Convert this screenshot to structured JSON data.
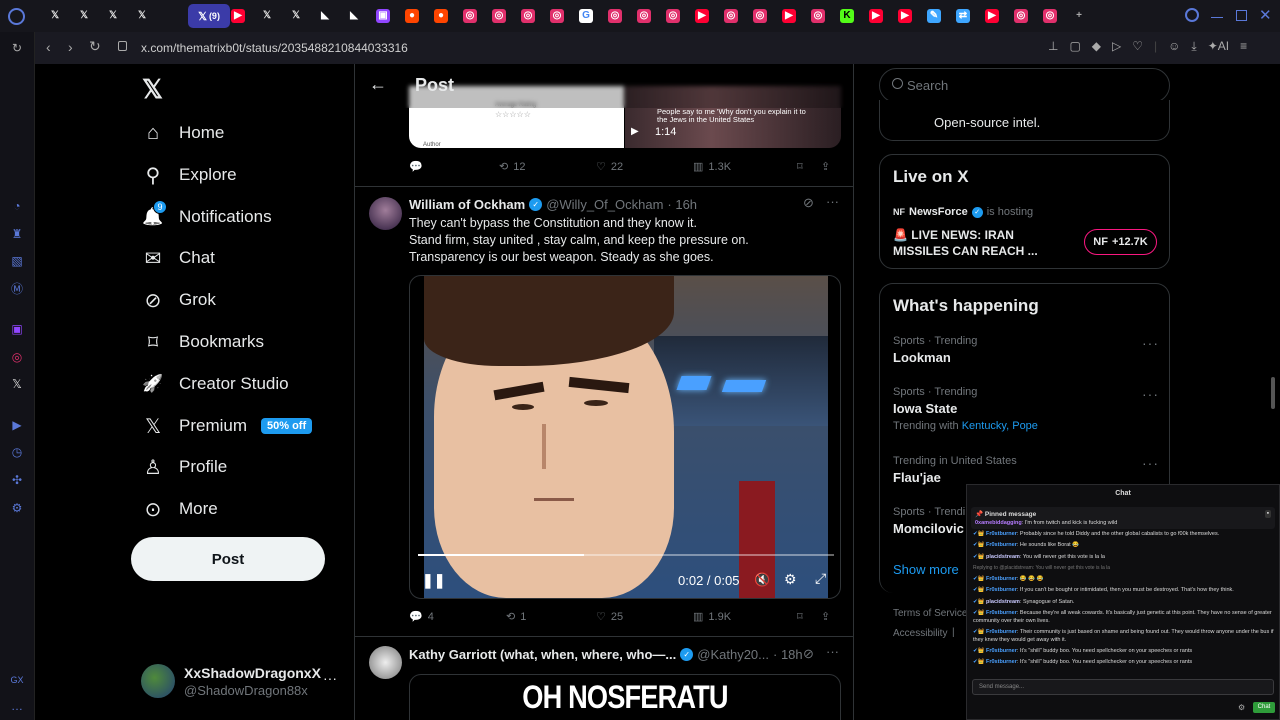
{
  "browser": {
    "active_tab_label": "(9)",
    "url": "x.com/thematrixb0t/status/2035488210844033316",
    "tab_icons": [
      "x-logo",
      "x-logo",
      "x-logo",
      "x-logo",
      "youtube",
      "youtube",
      "x-logo",
      "x-logo",
      "reader",
      "reader",
      "twitch",
      "reddit",
      "reddit",
      "instagram",
      "instagram",
      "instagram",
      "instagram",
      "google",
      "instagram",
      "instagram",
      "instagram",
      "youtube",
      "instagram",
      "instagram",
      "youtube",
      "instagram",
      "kick",
      "youtube",
      "youtube",
      "edit",
      "translate",
      "youtube",
      "instagram",
      "instagram",
      "plus"
    ]
  },
  "nav": {
    "items": [
      {
        "label": "Home",
        "icon": "home-icon"
      },
      {
        "label": "Explore",
        "icon": "search-icon"
      },
      {
        "label": "Notifications",
        "icon": "bell-icon",
        "badge": "9"
      },
      {
        "label": "Chat",
        "icon": "mail-icon"
      },
      {
        "label": "Grok",
        "icon": "grok-icon"
      },
      {
        "label": "Bookmarks",
        "icon": "bookmark-icon"
      },
      {
        "label": "Creator Studio",
        "icon": "rocket-icon"
      },
      {
        "label": "Premium",
        "icon": "x-logo-icon",
        "badge": "50% off"
      },
      {
        "label": "Profile",
        "icon": "person-icon"
      },
      {
        "label": "More",
        "icon": "more-circle-icon"
      }
    ],
    "post_button": "Post",
    "account": {
      "name": "XxShadowDragonxX",
      "handle": "@ShadowDragon88x"
    }
  },
  "header": {
    "title": "Post"
  },
  "prev_post": {
    "rating_label": "Average Rating",
    "author_label": "Author",
    "video_caption": "People say to me 'Why don't you explain it to the Jews in the United States",
    "video_time": "1:14",
    "stats": {
      "replies": "",
      "reposts": "12",
      "likes": "22",
      "views": "1.3K"
    }
  },
  "post": {
    "name": "William of Ockham",
    "handle": "@Willy_Of_Ockham",
    "time": "· 16h",
    "lines": [
      "They can't bypass the Constitution and they know it.",
      "Stand firm, stay united , stay  calm, and  keep the pressure on.",
      "Transparency is our best weapon.  Steady as she goes."
    ],
    "video": {
      "time": "0:02 / 0:05",
      "progress": 0.4
    },
    "stats": {
      "replies": "4",
      "reposts": "1",
      "likes": "25",
      "views": "1.9K"
    }
  },
  "next_post": {
    "name": "Kathy Garriott (what, when, where, who—...",
    "handle": "@Kathy20...",
    "time": "· 18h",
    "image_text": "OH NOSFERATU"
  },
  "right": {
    "search_placeholder": "Search",
    "top_card_text": "Open-source intel.",
    "live": {
      "title": "Live on X",
      "host": "NewsForce",
      "hosting": "is hosting",
      "headline_line1": "🚨 LIVE NEWS: IRAN",
      "headline_line2": "MISSILES CAN REACH ...",
      "count": "+12.7K"
    },
    "happening": {
      "title": "What's happening",
      "trends": [
        {
          "category": "Sports · Trending",
          "name": "Lookman"
        },
        {
          "category": "Sports · Trending",
          "name": "Iowa State",
          "with_label": "Trending with",
          "with_links": "Kentucky, Pope"
        },
        {
          "category": "Trending in United States",
          "name": "Flau'jae"
        },
        {
          "category": "Sports · Trendi",
          "name": "Momcilovic"
        }
      ],
      "show_more": "Show more"
    },
    "footer": {
      "terms": "Terms of Service",
      "accessibility": "Accessibility"
    }
  },
  "chat": {
    "title": "Chat",
    "pinned_label": "Pinned message",
    "pinned_user": "0xamebiddagging",
    "pinned_text": ": I'm from twitch and kick is fucking wild",
    "messages": [
      {
        "user": "Fr0stburner",
        "text": "Probably since he told Diddy and the other global cabalists to go f00k themselves."
      },
      {
        "user": "Fr0stburner",
        "text": "He sounds like Borat 😂"
      },
      {
        "user": "placidstream",
        "text": "You will never get this vote is la la"
      },
      {
        "user": "",
        "text": "Replying to @placidstream: You will never get this vote is la la"
      },
      {
        "user": "Fr0stburner",
        "text": "😂 😂 😂"
      },
      {
        "user": "Fr0stburner",
        "text": "If you can't be bought or intimidated, then you must be destroyed. That's how they think."
      },
      {
        "user": "placidstream",
        "text": "Synagogue of Satan."
      },
      {
        "user": "Fr0stburner",
        "text": "Because they're all weak cowards. It's basically just genetic at this point. They have no sense of greater community over their own lives."
      },
      {
        "user": "Fr0stburner",
        "text": "Their community is just based on shame and being found out. They would throw anyone under the bus if they knew they would get away with it."
      },
      {
        "user": "Fr0stburner",
        "text": "It's \"shill\" buddy boo. You need spellchecker on your speeches or rants"
      },
      {
        "user": "Fr0stburner",
        "text": "It's \"shill\" buddy boo. You need spellchecker on your speeches or rants"
      }
    ],
    "input_placeholder": "Send message...",
    "send_label": "Chat"
  }
}
